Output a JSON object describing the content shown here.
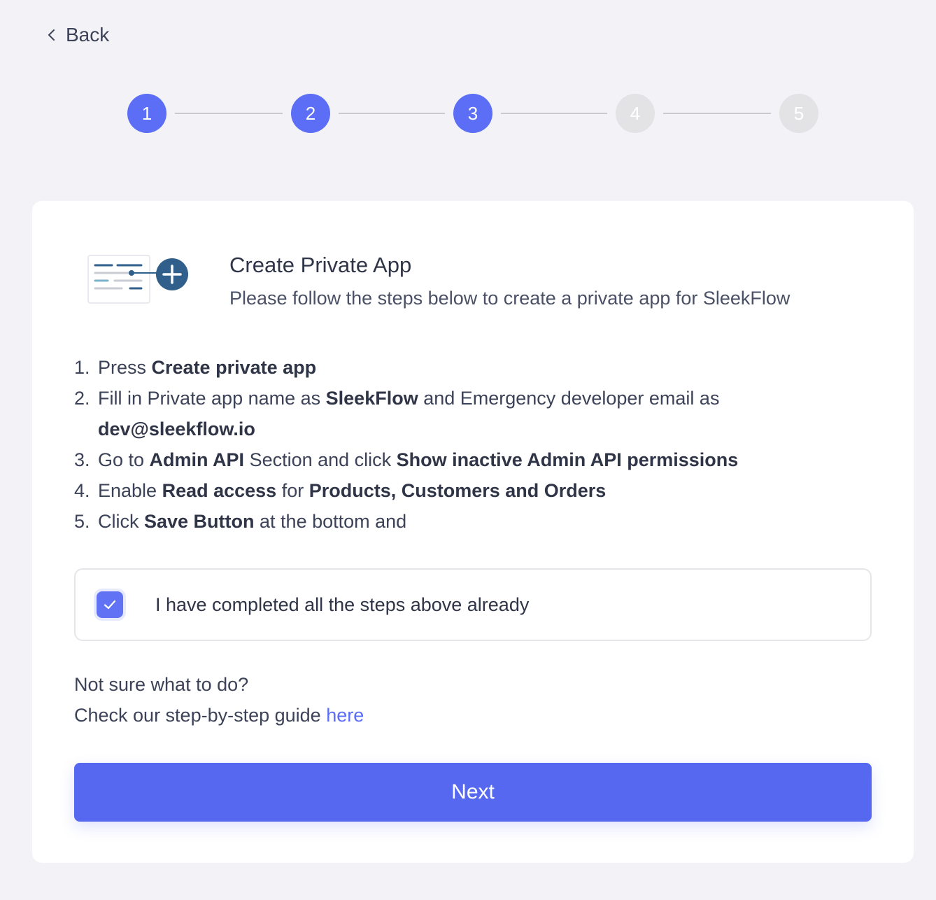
{
  "nav": {
    "back_label": "Back"
  },
  "stepper": {
    "steps": [
      {
        "label": "1",
        "state": "active"
      },
      {
        "label": "2",
        "state": "active"
      },
      {
        "label": "3",
        "state": "active"
      },
      {
        "label": "4",
        "state": "inactive"
      },
      {
        "label": "5",
        "state": "inactive"
      }
    ],
    "colors": {
      "active": "#5b6ef5",
      "inactive": "#e3e3e6"
    }
  },
  "header": {
    "icon": "private-app-add-icon",
    "title": "Create Private App",
    "subtitle": "Please follow the steps below to create a private app for SleekFlow"
  },
  "instructions": {
    "step1": {
      "num": "1.",
      "a": "Press ",
      "b": "Create private app"
    },
    "step2": {
      "num": "2.",
      "a": "Fill in Private app name as ",
      "b": "SleekFlow",
      "c": " and Emergency developer email as",
      "d": "dev@sleekflow.io"
    },
    "step3": {
      "num": "3.",
      "a": "Go to ",
      "b": "Admin API",
      "c": " Section and click ",
      "d": "Show inactive Admin API permissions"
    },
    "step4": {
      "num": "4.",
      "a": "Enable ",
      "b": "Read access",
      "c": " for ",
      "d": "Products, Customers and Orders"
    },
    "step5": {
      "num": "5.",
      "a": "Click ",
      "b": "Save Button",
      "c": " at the bottom and"
    }
  },
  "confirm": {
    "checked": true,
    "label": "I have completed all the steps above already"
  },
  "help": {
    "title": "Not sure what to do?",
    "text": "Check our step-by-step guide ",
    "link_label": "here"
  },
  "actions": {
    "next_label": "Next"
  },
  "theme": {
    "accent": "#5568ef",
    "link": "#5b6ef5",
    "background": "#f3f3f7"
  }
}
